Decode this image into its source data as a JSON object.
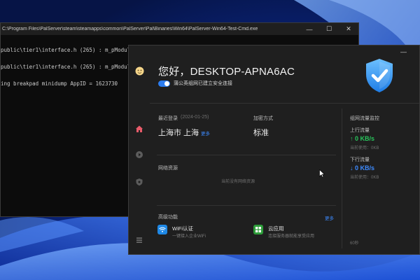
{
  "terminal": {
    "title": "C:\\Program Files\\PalServer\\steam\\steamapps\\common\\PalServer\\Pal\\Binaries\\Win64\\PalServer-Win64-Test-Cmd.exe",
    "lines": [
      "public\\tier1\\interface.h (265) : m_pModule",
      "public\\tier1\\interface.h (265) : m_pModule",
      "ing breakpad minidump AppID = 1623730"
    ],
    "controls": {
      "minimize": "—",
      "maximize": "☐",
      "close": "✕"
    }
  },
  "app": {
    "minimize": "—",
    "greeting": "您好，DESKTOP-APNA6AC",
    "toggle_label": "蒲公英组网已建立安全连接",
    "last_login_label": "最近登录",
    "last_login_date": "(2024-01-25)",
    "location": "上海市 上海",
    "location_more": "更多",
    "encryption_label": "加密方式",
    "encryption_value": "标准",
    "network_resources_label": "网络资源",
    "network_resources_empty": "当前没有网络资源",
    "advanced_label": "高级功能",
    "advanced_more": "更多",
    "features": [
      {
        "title": "WiFi认证",
        "subtitle": "一键接入企业WiFi",
        "icon": "wifi-icon",
        "color": "#1e88e5"
      },
      {
        "title": "云应用",
        "subtitle": "连接服务器就能享受应用",
        "icon": "apps-icon",
        "color": "#2e9d3a"
      }
    ],
    "traffic": {
      "title": "组网流量监控",
      "upload_label": "上行流量",
      "upload_speed": "↑ 0 KB/s",
      "upload_used": "当前使用：0KB",
      "download_label": "下行流量",
      "download_speed": "↓ 0 KB/s",
      "download_used": "当前使用：0KB",
      "interval": "60秒"
    },
    "sidebar_icons": [
      "avatar-icon",
      "home-icon",
      "play-icon",
      "shield-icon",
      "menu-icon"
    ]
  },
  "colors": {
    "accent_blue": "#3d8bff",
    "upload_green": "#29c45c",
    "home_active": "#e85b6a"
  }
}
